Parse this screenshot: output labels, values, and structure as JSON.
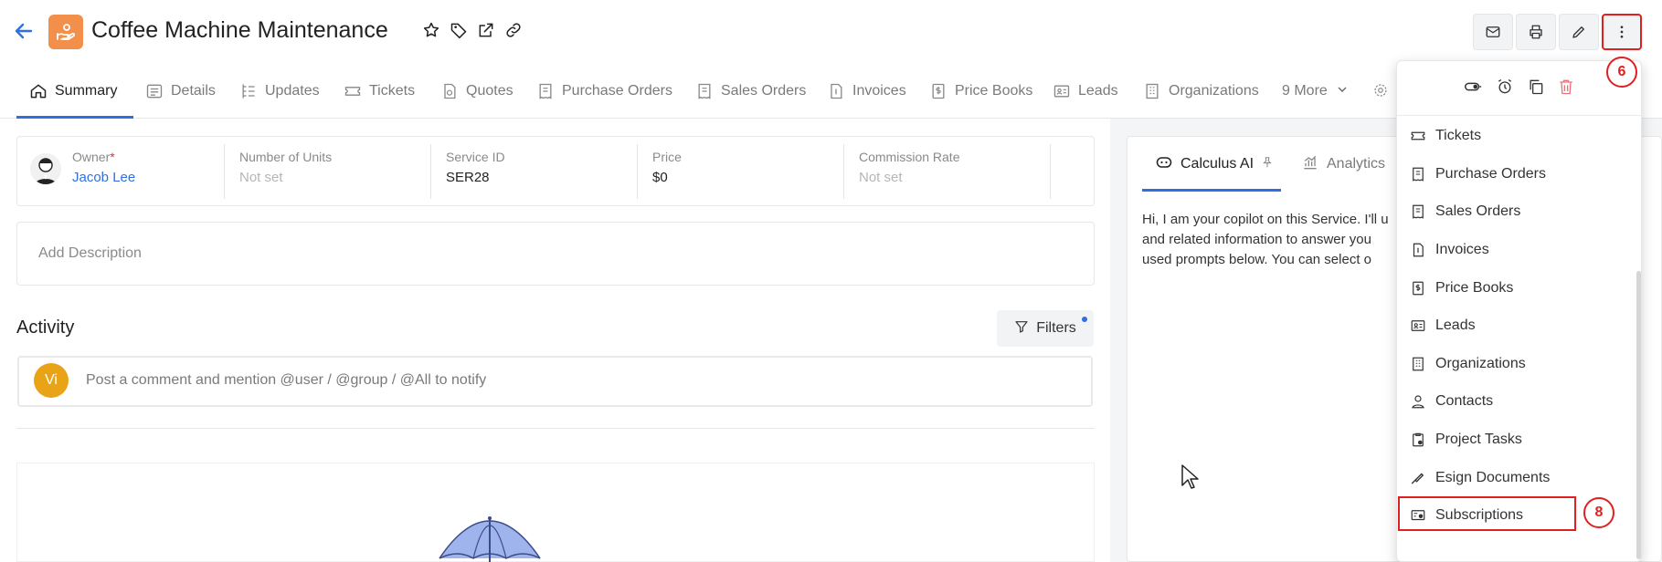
{
  "header": {
    "title": "Coffee Machine Maintenance"
  },
  "tabs": [
    {
      "label": "Summary",
      "icon": "home-icon"
    },
    {
      "label": "Details",
      "icon": "list-icon"
    },
    {
      "label": "Updates",
      "icon": "updates-icon"
    },
    {
      "label": "Tickets",
      "icon": "ticket-icon"
    },
    {
      "label": "Quotes",
      "icon": "quote-icon"
    },
    {
      "label": "Purchase Orders",
      "icon": "receipt-icon"
    },
    {
      "label": "Sales Orders",
      "icon": "receipt-icon"
    },
    {
      "label": "Invoices",
      "icon": "invoice-icon"
    },
    {
      "label": "Price Books",
      "icon": "dollar-doc-icon"
    },
    {
      "label": "Leads",
      "icon": "id-card-icon"
    },
    {
      "label": "Organizations",
      "icon": "building-icon"
    },
    {
      "label": "9 More",
      "icon": "chevron-down-icon"
    }
  ],
  "fields": [
    {
      "label": "Owner",
      "required": "*",
      "value": "Jacob Lee"
    },
    {
      "label": "Number of Units",
      "value": "Not set"
    },
    {
      "label": "Service ID",
      "value": "SER28"
    },
    {
      "label": "Price",
      "value": "$0"
    },
    {
      "label": "Commission Rate",
      "value": "Not set"
    }
  ],
  "description": {
    "placeholder": "Add Description"
  },
  "activity": {
    "title": "Activity",
    "filters_label": "Filters",
    "comment_avatar": "Vi",
    "comment_placeholder": "Post a comment and mention @user / @group / @All to notify"
  },
  "ai_panel": {
    "tab_ai": "Calculus AI",
    "tab_analytics": "Analytics",
    "lines": [
      "Hi, I am your copilot on this Service. I'll u",
      "and related information to answer you",
      "used prompts below. You can select o"
    ]
  },
  "menu": {
    "items": [
      "Tickets",
      "Purchase Orders",
      "Sales Orders",
      "Invoices",
      "Price Books",
      "Leads",
      "Organizations",
      "Contacts",
      "Project Tasks",
      "Esign Documents",
      "Subscriptions"
    ]
  },
  "annotations": {
    "badge_more": "6",
    "badge_subscriptions": "8"
  },
  "colors": {
    "accent": "#2f6fe0",
    "record_icon": "#f28f4a",
    "annotation": "#e02020",
    "avatar": "#e8a317"
  }
}
